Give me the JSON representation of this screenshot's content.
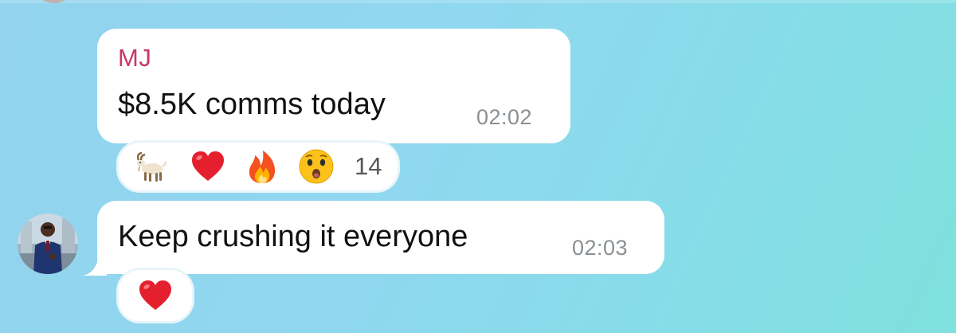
{
  "messages": [
    {
      "sender": "MJ",
      "text": "$8.5K comms today",
      "time": "02:02",
      "reactions": {
        "emojis": [
          "goat-emoji",
          "red-heart-emoji",
          "fire-emoji",
          "astonished-face-emoji"
        ],
        "count": "14"
      }
    },
    {
      "text": "Keep crushing it everyone",
      "time": "02:03",
      "reactions": {
        "emojis": [
          "red-heart-emoji"
        ]
      }
    }
  ],
  "colors": {
    "sender_name": "#c8356b",
    "bubble": "#ffffff",
    "timestamp": "#8a8f93",
    "background_start": "#93d3ee",
    "background_end": "#7fe0dc"
  }
}
